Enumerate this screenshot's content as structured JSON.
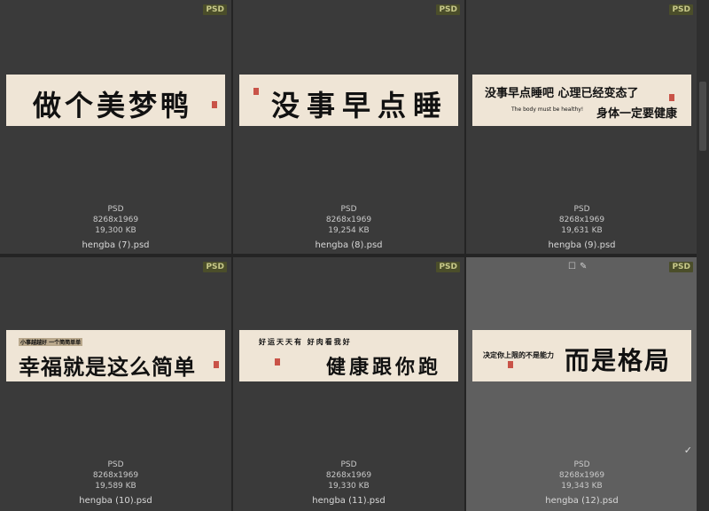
{
  "items": [
    {
      "badge": "PSD",
      "thumb_main": "做个美梦鸭",
      "format": "PSD",
      "dims": "8268x1969",
      "size": "19,300 KB",
      "filename": "hengba (7).psd"
    },
    {
      "badge": "PSD",
      "thumb_main": "没事早点睡",
      "format": "PSD",
      "dims": "8268x1969",
      "size": "19,254 KB",
      "filename": "hengba (8).psd"
    },
    {
      "badge": "PSD",
      "thumb_line1": "没事早点睡吧 心理已经变态了",
      "thumb_small": "The body must be healthy!",
      "thumb_line2": "身体一定要健康",
      "format": "PSD",
      "dims": "8268x1969",
      "size": "19,631 KB",
      "filename": "hengba (9).psd"
    },
    {
      "badge": "PSD",
      "thumb_top": "小事越越好 一个简简单单",
      "thumb_main": "幸福就是这么简单",
      "format": "PSD",
      "dims": "8268x1969",
      "size": "19,589 KB",
      "filename": "hengba (10).psd"
    },
    {
      "badge": "PSD",
      "thumb_top": "好运天天有 好肉看我好",
      "thumb_main": "健康跟你跑",
      "format": "PSD",
      "dims": "8268x1969",
      "size": "19,330 KB",
      "filename": "hengba (11).psd"
    },
    {
      "badge": "PSD",
      "thumb_small": "决定你上限的不是能力",
      "thumb_main": "而是格局",
      "format": "PSD",
      "dims": "8268x1969",
      "size": "19,343 KB",
      "filename": "hengba (12).psd",
      "selected": true
    }
  ]
}
